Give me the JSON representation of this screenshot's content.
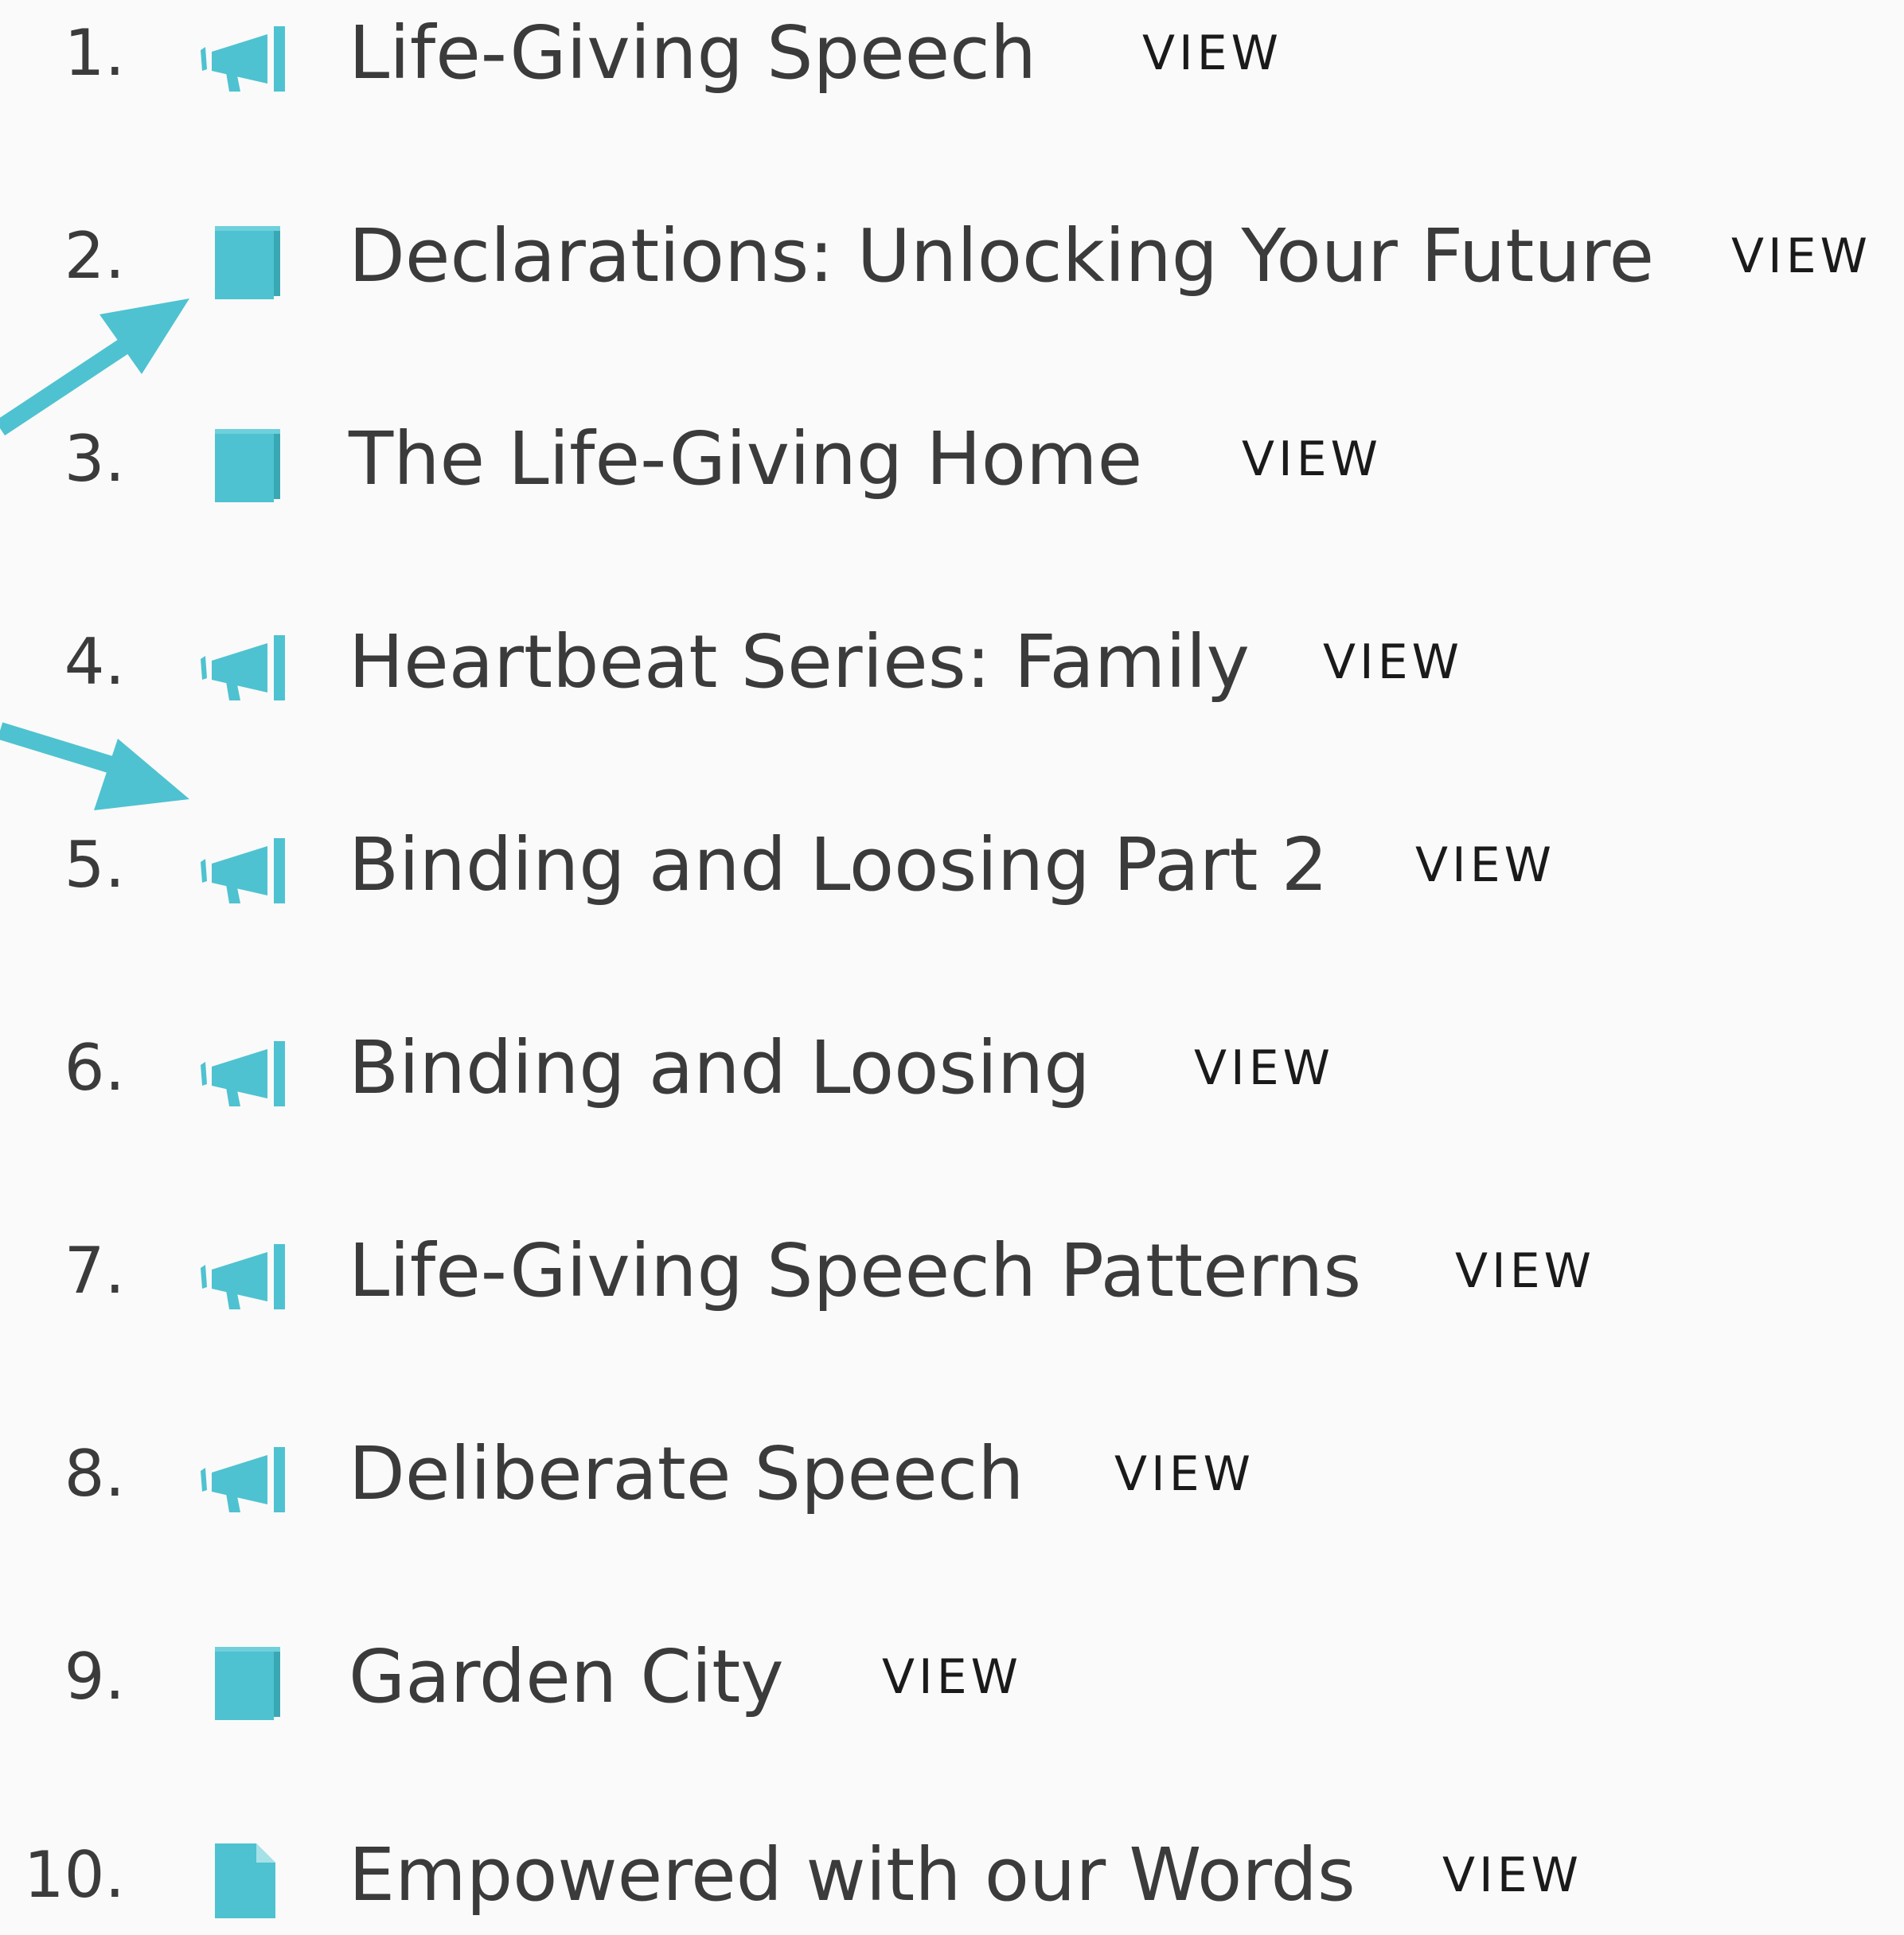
{
  "accent_color": "#4ec2d0",
  "items": [
    {
      "number": "1.",
      "icon": "megaphone-icon",
      "title": "Life-Giving Speech",
      "action": "VIEW"
    },
    {
      "number": "2.",
      "icon": "book-icon",
      "title": "Declarations: Unlocking Your Future",
      "action": "VIEW"
    },
    {
      "number": "3.",
      "icon": "book-icon",
      "title": "The Life-Giving Home",
      "action": "VIEW"
    },
    {
      "number": "4.",
      "icon": "megaphone-icon",
      "title": "Heartbeat Series: Family",
      "action": "VIEW"
    },
    {
      "number": "5.",
      "icon": "megaphone-icon",
      "title": "Binding and Loosing Part 2",
      "action": "VIEW"
    },
    {
      "number": "6.",
      "icon": "megaphone-icon",
      "title": "Binding and Loosing",
      "action": "VIEW"
    },
    {
      "number": "7.",
      "icon": "megaphone-icon",
      "title": "Life-Giving Speech Patterns",
      "action": "VIEW"
    },
    {
      "number": "8.",
      "icon": "megaphone-icon",
      "title": "Deliberate Speech",
      "action": "VIEW"
    },
    {
      "number": "9.",
      "icon": "book-icon",
      "title": "Garden City",
      "action": "VIEW"
    },
    {
      "number": "10.",
      "icon": "document-icon",
      "title": "Empowered with our Words",
      "action": "VIEW"
    }
  ]
}
